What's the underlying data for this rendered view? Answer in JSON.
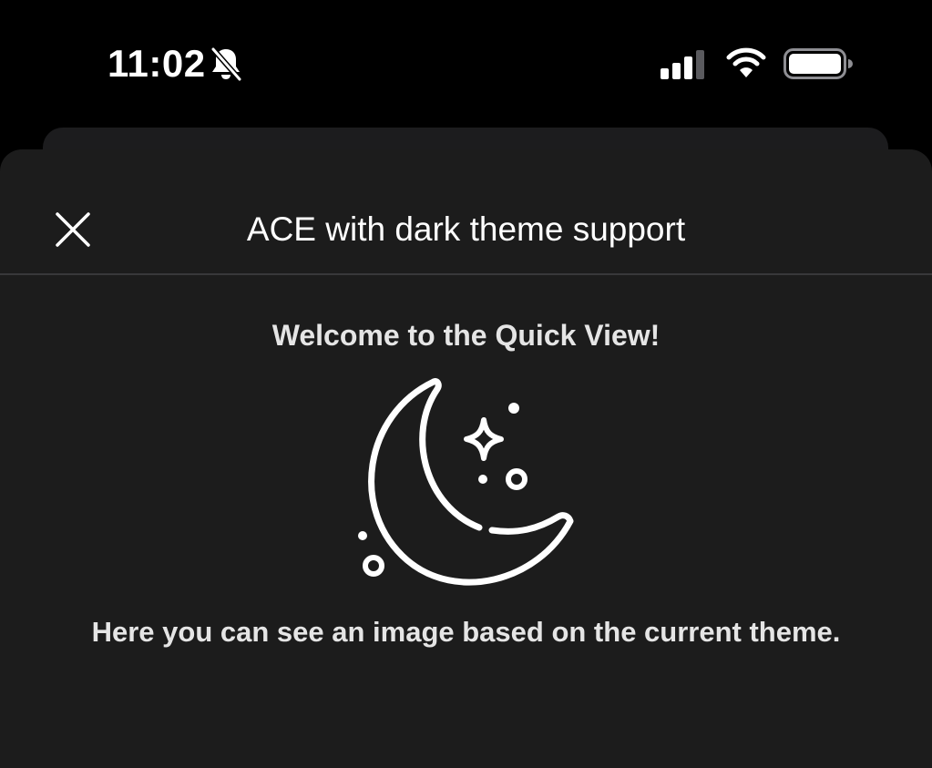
{
  "status_bar": {
    "time": "11:02",
    "icons": [
      "bell-slash-icon",
      "cellular-signal-icon",
      "wifi-icon",
      "battery-icon"
    ]
  },
  "sheet": {
    "title": "ACE with dark theme support",
    "close_icon": "close-icon"
  },
  "content": {
    "heading": "Welcome to the Quick View!",
    "image_icon": "moon-stars-icon",
    "description": "Here you can see an image based on the current theme."
  },
  "colors": {
    "background": "#000000",
    "sheet_background": "#1c1c1c",
    "back_card": "#1c1c1e",
    "divider": "#38383a",
    "text_primary": "#ffffff",
    "text_secondary": "#e5e5e5"
  }
}
